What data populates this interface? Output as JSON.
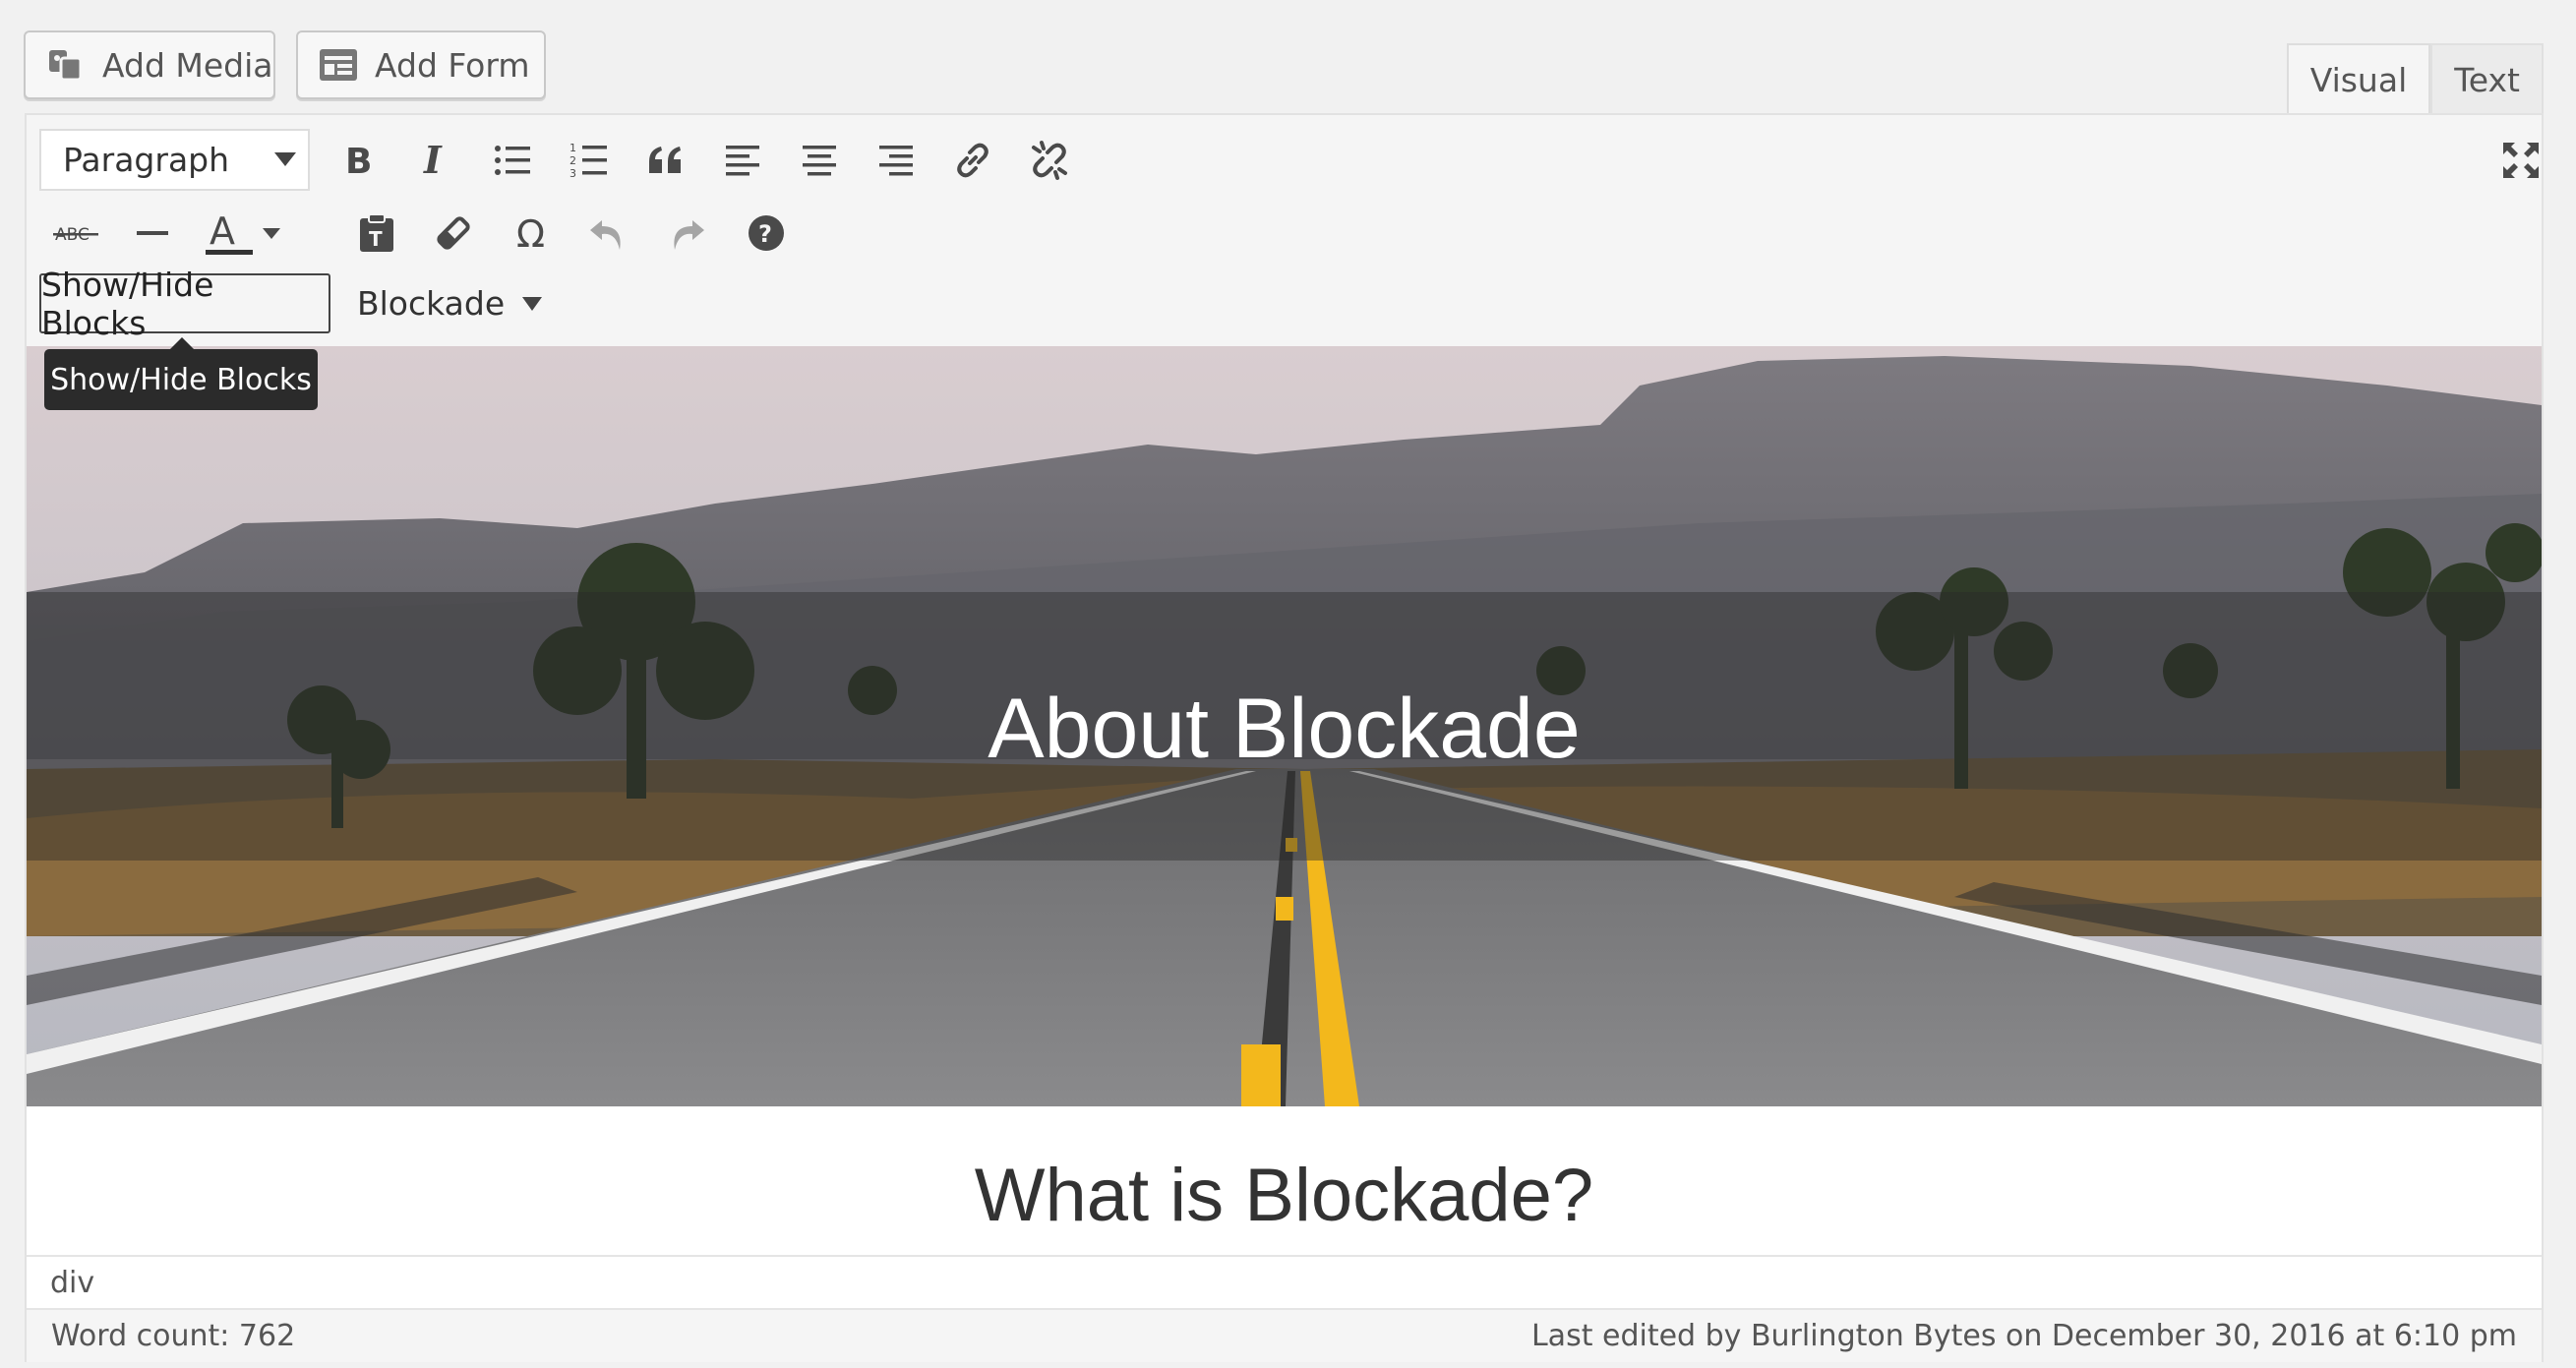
{
  "media_buttons": {
    "add_media": "Add Media",
    "add_form": "Add Form"
  },
  "tabs": {
    "visual": "Visual",
    "text": "Text"
  },
  "toolbar": {
    "format_select": "Paragraph",
    "row1_icons": [
      "bold-icon",
      "italic-icon",
      "bulleted-list-icon",
      "numbered-list-icon",
      "blockquote-icon",
      "align-left-icon",
      "align-center-icon",
      "align-right-icon",
      "insert-link-icon",
      "remove-link-icon"
    ],
    "row2_icons": [
      "strikethrough-icon",
      "horizontal-line-icon",
      "text-color-icon",
      "paste-as-text-icon",
      "clear-formatting-icon",
      "special-character-icon",
      "undo-icon",
      "redo-icon",
      "help-icon"
    ],
    "strikethrough_glyph": "ABC",
    "text_color_glyph": "A",
    "show_hide_blocks": "Show/Hide Blocks",
    "blockade_menu": "Blockade"
  },
  "tooltip": "Show/Hide Blocks",
  "content": {
    "hero_title": "About Blockade",
    "heading": "What is Blockade?"
  },
  "path_bar": "div",
  "status": {
    "word_count": "Word count: 762",
    "last_edited": "Last edited by Burlington Bytes on December 30, 2016 at 6:10 pm"
  },
  "colors": {
    "accent": "#f3b81c",
    "tooltip_bg": "#2b2b2b"
  }
}
